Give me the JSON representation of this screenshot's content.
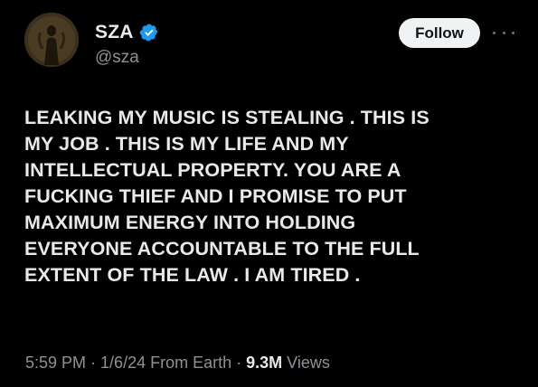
{
  "author": {
    "display_name": "SZA",
    "handle": "@sza",
    "verified": true,
    "avatar_icon": "profile-photo"
  },
  "actions": {
    "follow_label": "Follow",
    "more_icon": "more-horizontal-icon"
  },
  "tweet": {
    "lines": [
      "LEAKING MY MUSIC IS STEALING . THIS IS",
      "MY JOB . THIS IS MY LIFE AND MY",
      "INTELLECTUAL PROPERTY. YOU ARE A",
      "FUCKING THIEF AND I PROMISE TO PUT",
      "MAXIMUM ENERGY INTO HOLDING",
      "EVERYONE ACCOUNTABLE TO THE FULL",
      "EXTENT OF THE LAW . I AM TIRED ."
    ]
  },
  "meta": {
    "time": "5:59 PM",
    "separator": " · ",
    "date": "1/6/24 From Earth",
    "views_count": "9.3M",
    "views_label": " Views"
  },
  "colors": {
    "background": "#000000",
    "text_primary": "#e7e9ea",
    "text_secondary": "#8b9298",
    "verified_blue": "#1d9bf0",
    "follow_bg": "#eff3f4"
  }
}
